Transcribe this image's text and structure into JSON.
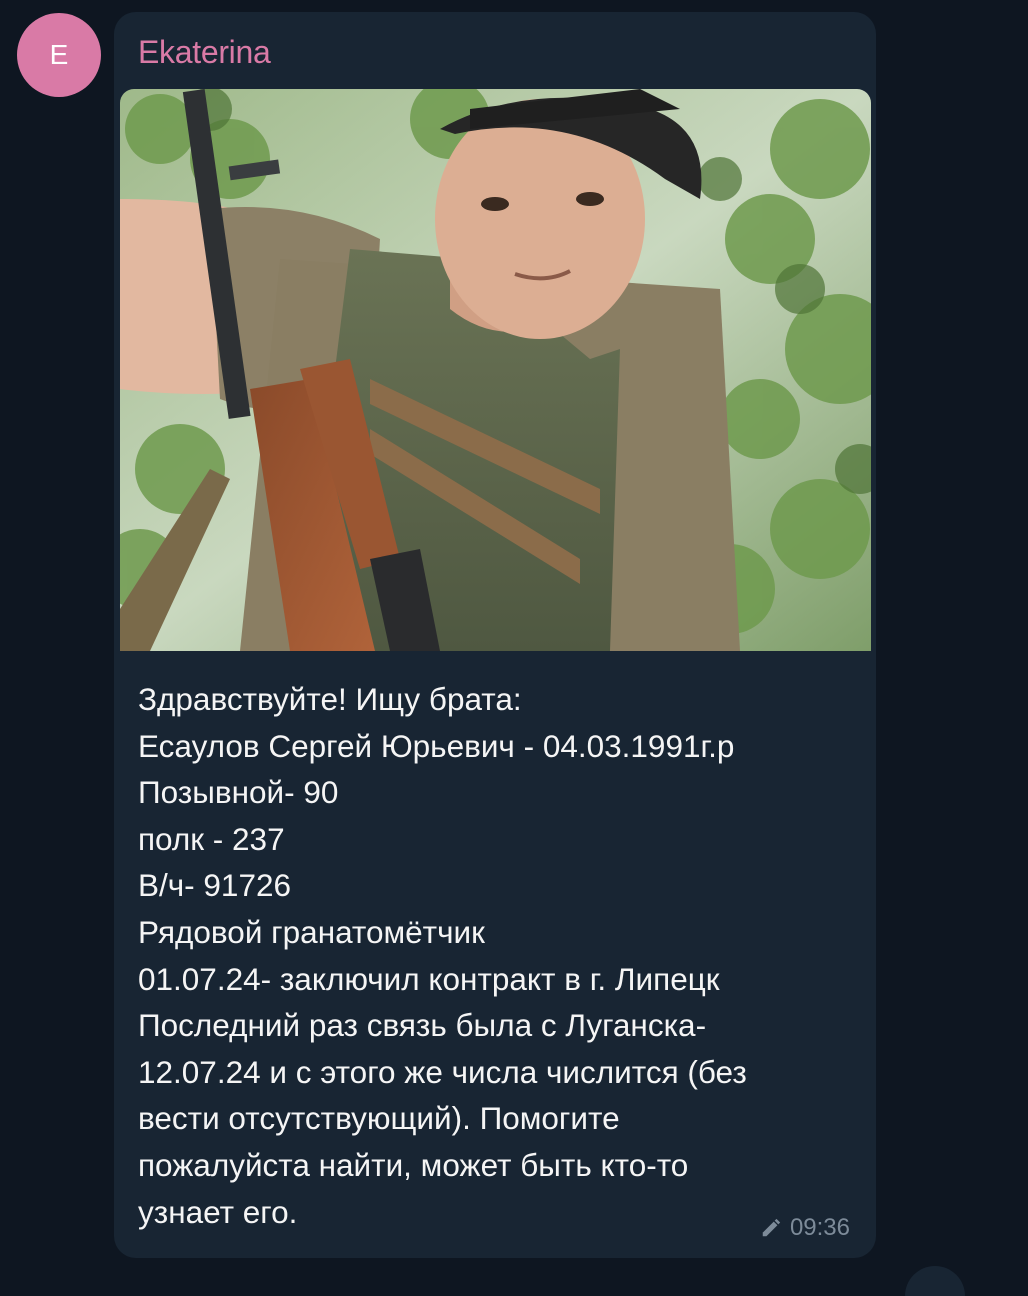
{
  "message": {
    "avatar_letter": "E",
    "sender_name": "Ekaterina",
    "photo_subject": "photo",
    "text": "Здравствуйте! Ищу брата:\nЕсаулов Сергей Юрьевич - 04.03.1991г.р\nПозывной- 90\nполк - 237\nВ/ч- 91726\nРядовой гранатомётчик\n01.07.24- заключил контракт в г. Липецк\nПоследний раз связь была с Луганска-\n12.07.24 и с этого же числа числится (без\nвести отсутствующий). Помогите\nпожалуйста найти, может быть кто-то\nузнает его.",
    "edited_icon": "pencil-icon",
    "time": "09:36"
  },
  "colors": {
    "background": "#0e1621",
    "bubble": "#182533",
    "sender_name": "#d97aa6",
    "avatar": "#d97aa6",
    "text": "#f5f5f5",
    "meta": "#7d8b99"
  }
}
